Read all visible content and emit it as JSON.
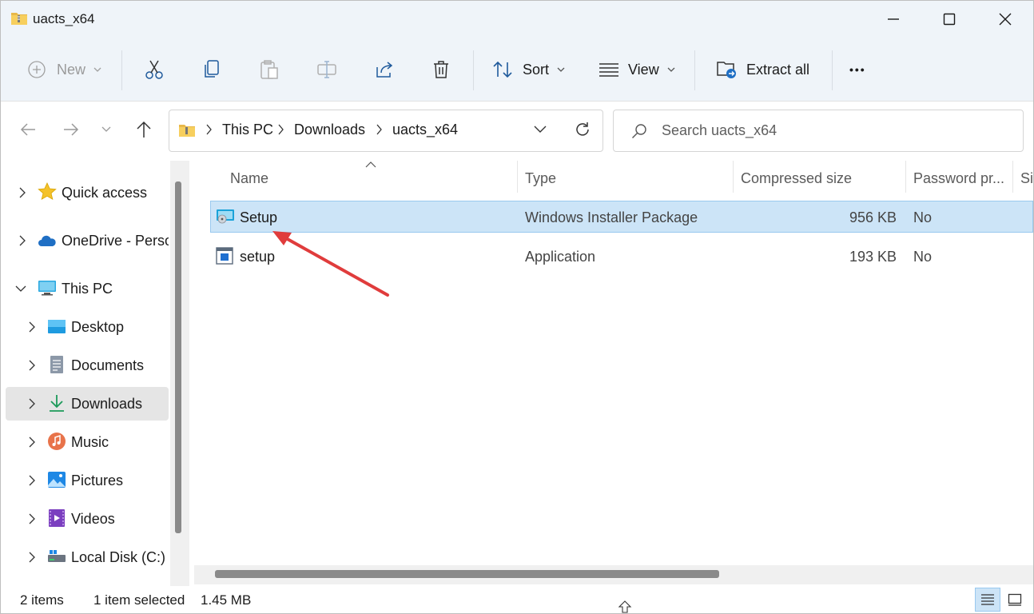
{
  "window": {
    "title": "uacts_x64"
  },
  "toolbar": {
    "new_label": "New",
    "sort_label": "Sort",
    "view_label": "View",
    "extract_label": "Extract all",
    "more_label": "•••"
  },
  "address": {
    "crumbs": [
      "This PC",
      "Downloads",
      "uacts_x64"
    ],
    "search_placeholder": "Search uacts_x64"
  },
  "sidebar": {
    "items": [
      {
        "label": "Quick access"
      },
      {
        "label": "OneDrive - Perso"
      },
      {
        "label": "This PC"
      },
      {
        "label": "Desktop"
      },
      {
        "label": "Documents"
      },
      {
        "label": "Downloads"
      },
      {
        "label": "Music"
      },
      {
        "label": "Pictures"
      },
      {
        "label": "Videos"
      },
      {
        "label": "Local Disk (C:)"
      }
    ]
  },
  "columns": [
    "Name",
    "Type",
    "Compressed size",
    "Password pr...",
    "Si"
  ],
  "files": [
    {
      "name": "Setup",
      "type": "Windows Installer Package",
      "compressed_size": "956 KB",
      "password": "No"
    },
    {
      "name": "setup",
      "type": "Application",
      "compressed_size": "193 KB",
      "password": "No"
    }
  ],
  "status": {
    "items": "2 items",
    "selected": "1 item selected",
    "size": "1.45 MB"
  },
  "colors": {
    "selection": "#cce4f7",
    "selection_border": "#99c9ef",
    "annotation_arrow": "#e03c3c",
    "commandbar_bg": "#eff4f9"
  }
}
